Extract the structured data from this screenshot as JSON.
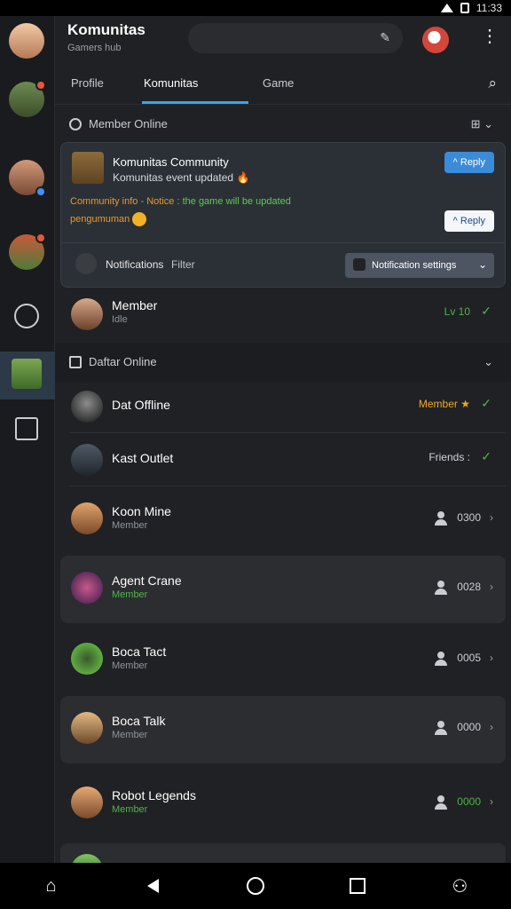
{
  "status_bar": {
    "time": "11:33"
  },
  "rail": {
    "items": [
      {
        "name": "profile-avatar"
      },
      {
        "name": "community-1"
      },
      {
        "name": "community-2"
      },
      {
        "name": "community-3"
      },
      {
        "name": "compass-icon"
      },
      {
        "name": "community-active"
      },
      {
        "name": "clipboard-icon"
      }
    ]
  },
  "header": {
    "title": "Komunitas",
    "subtitle": "Gamers hub",
    "search": {
      "placeholder": ""
    }
  },
  "tabs": [
    {
      "label": "Profile"
    },
    {
      "label": "Komunitas"
    },
    {
      "label": "Game"
    }
  ],
  "section_online": {
    "title": "Member Online",
    "right": ""
  },
  "featured_card": {
    "title": "Komunitas Community",
    "subtitle": "Komunitas event updated",
    "btn_primary": "^ Reply",
    "note_part1": "Community info",
    "note_part2": "Notice",
    "note_part3": "the game will be updated",
    "note_line2": "pengumuman",
    "btn_secondary": "^ Reply",
    "foot_label": "Notifications",
    "foot_label2": "Filter",
    "select_value": "Notification settings"
  },
  "rows_top": [
    {
      "name": "Member",
      "sub": "Idle",
      "right": "Lv 10",
      "check": "✓"
    }
  ],
  "section_members": {
    "title": "Daftar Online"
  },
  "rows": [
    {
      "name": "Dat Offline",
      "sub": "",
      "right": "Member ★",
      "right_style": "orange",
      "check": "✓"
    },
    {
      "name": "Kast Outlet",
      "sub": "",
      "right": "Friends :",
      "right_style": "",
      "check": "✓"
    },
    {
      "name": "Koon Mine",
      "sub": "Member",
      "count": "0300",
      "hl": false
    },
    {
      "name": "Agent Crane",
      "sub": "Member",
      "count": "0028",
      "hl": true
    },
    {
      "name": "Boca Tact",
      "sub": "Member",
      "count": "0005",
      "hl": false
    },
    {
      "name": "Boca Talk",
      "sub": "Member",
      "count": "0000",
      "hl": true
    },
    {
      "name": "Robot Legends",
      "sub": "Member",
      "count": "0000",
      "hl": false
    }
  ]
}
